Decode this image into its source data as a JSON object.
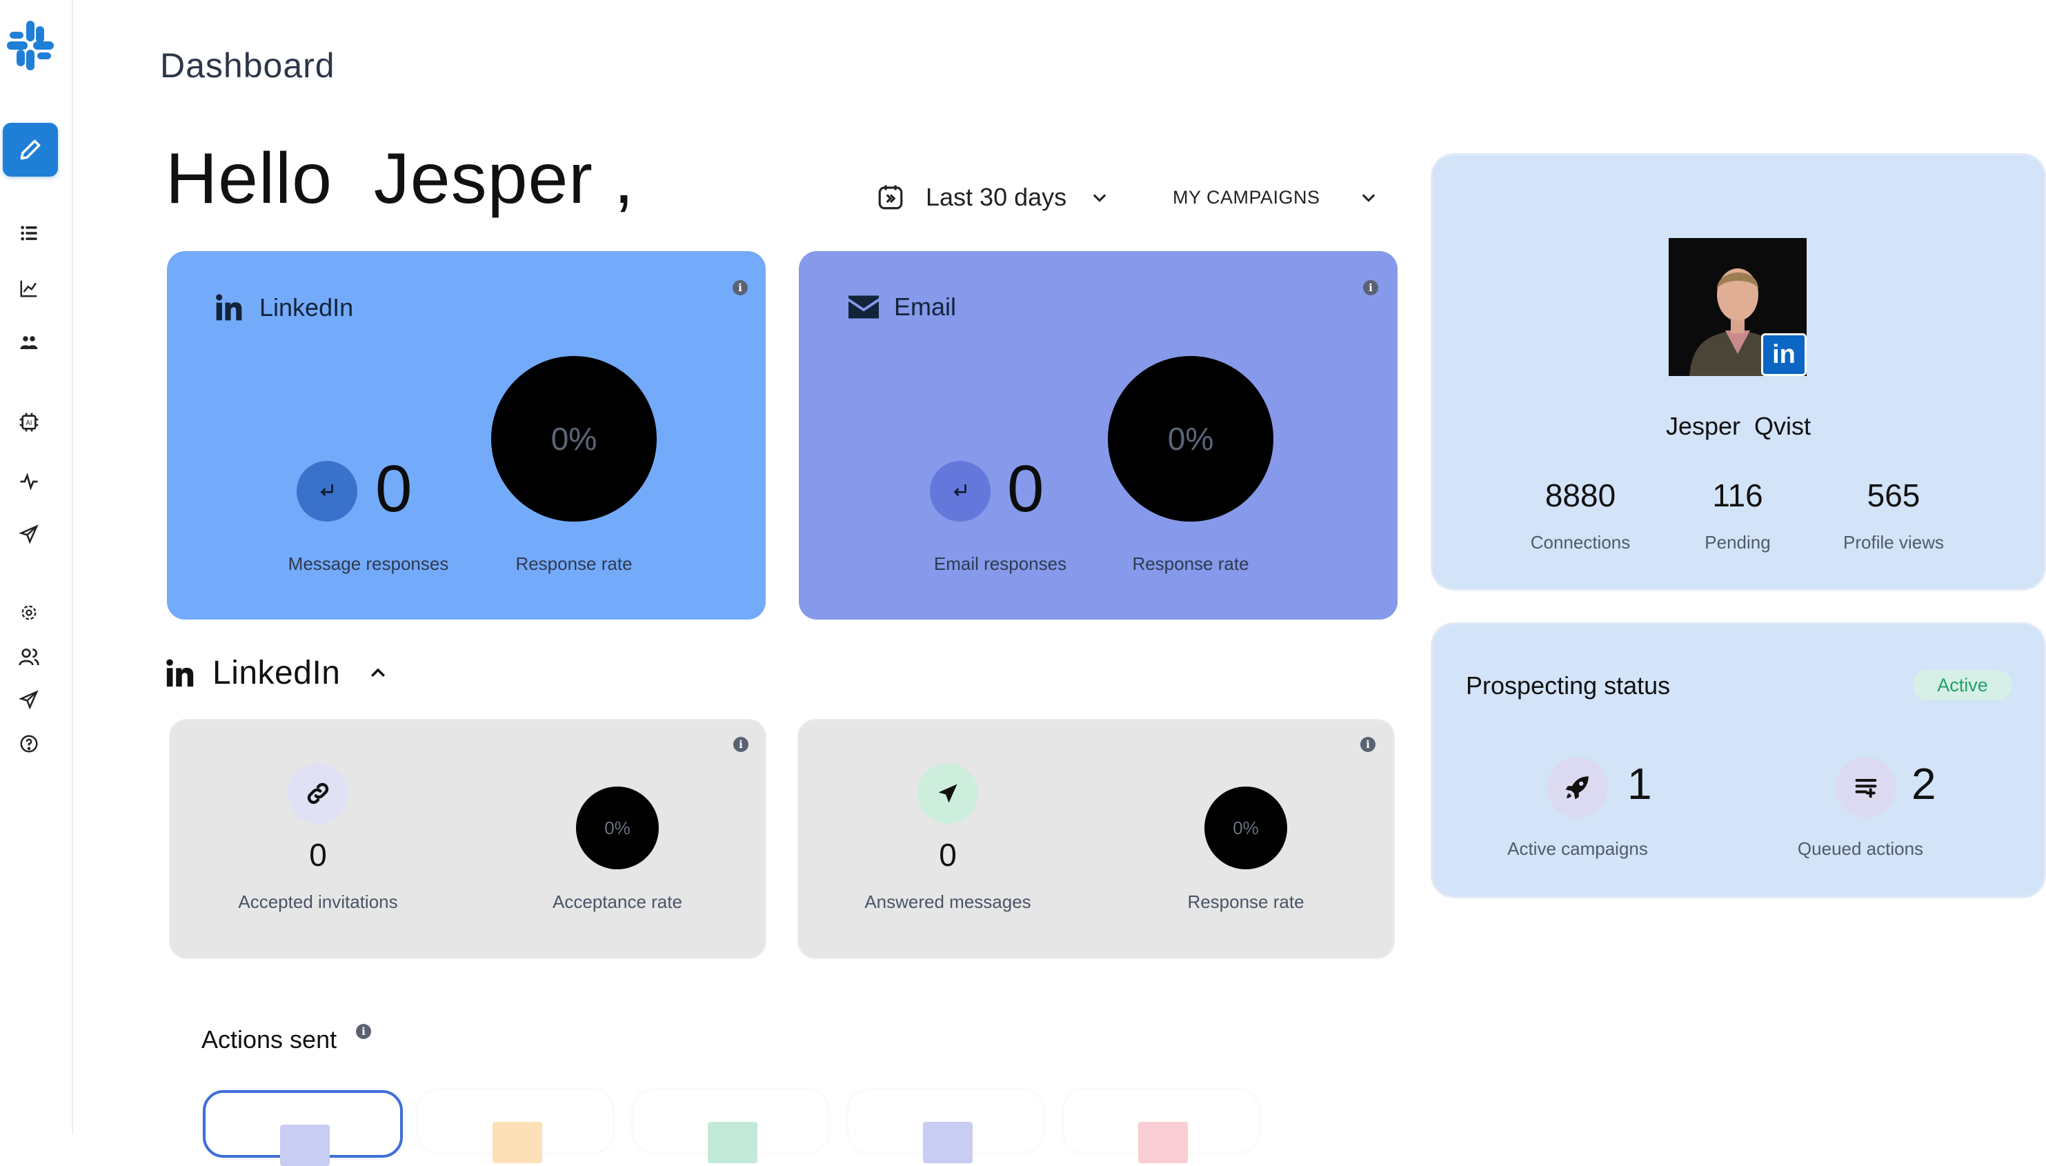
{
  "page": {
    "title": "Dashboard",
    "greeting": "Hello  Jesper ,"
  },
  "filters": {
    "date_range": "Last 30 days",
    "campaign_filter": "MY CAMPAIGNS"
  },
  "channels": {
    "linkedin": {
      "name": "LinkedIn",
      "responses_value": "0",
      "responses_label": "Message responses",
      "rate_value": "0%",
      "rate_label": "Response rate"
    },
    "email": {
      "name": "Email",
      "responses_value": "0",
      "responses_label": "Email responses",
      "rate_value": "0%",
      "rate_label": "Response rate"
    }
  },
  "linkedin_section": {
    "title": "LinkedIn",
    "invitations": {
      "value": "0",
      "label": "Accepted invitations",
      "rate_value": "0%",
      "rate_label": "Acceptance rate"
    },
    "messages": {
      "value": "0",
      "label": "Answered messages",
      "rate_value": "0%",
      "rate_label": "Response rate"
    }
  },
  "actions": {
    "title": "Actions sent",
    "tabs": [
      {
        "color": "#c9cdf3"
      },
      {
        "color": "#fde0b8"
      },
      {
        "color": "#c3ead9"
      },
      {
        "color": "#c9cdf3"
      },
      {
        "color": "#f9cdd3"
      }
    ]
  },
  "profile": {
    "name": "Jesper  Qvist",
    "badge": "in",
    "stats": [
      {
        "value": "8880",
        "label": "Connections"
      },
      {
        "value": "116",
        "label": "Pending"
      },
      {
        "value": "565",
        "label": "Profile views"
      }
    ]
  },
  "prospecting": {
    "title": "Prospecting status",
    "status": "Active",
    "active_campaigns": {
      "value": "1",
      "label": "Active campaigns"
    },
    "queued_actions": {
      "value": "2",
      "label": "Queued actions"
    }
  },
  "icons": {
    "info": "i"
  },
  "colors": {
    "accent": "#1f7fd6",
    "linkedin_card": "#74aafa",
    "email_card": "#8699ea",
    "side_panel": "#d3e3f8",
    "active_green": "#21a168"
  }
}
